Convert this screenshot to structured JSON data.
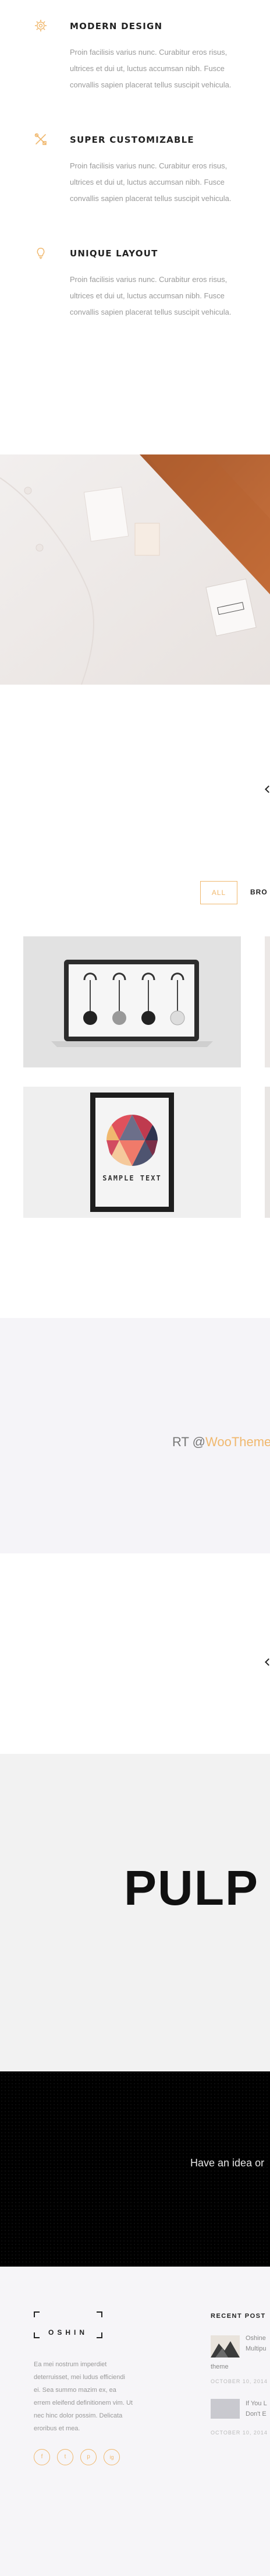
{
  "features": [
    {
      "icon": "gear-icon",
      "title": "MODERN DESIGN",
      "text": "Proin facilisis varius nunc. Curabitur eros risus, ultrices et dui ut, luctus accumsan nibh. Fusce convallis sapien placerat tellus suscipit vehicula."
    },
    {
      "icon": "tools-icon",
      "title": "SUPER  CUSTOMIZABLE",
      "text": "Proin facilisis varius nunc. Curabitur eros risus, ultrices et dui ut, luctus accumsan nibh. Fusce convallis sapien placerat tellus suscipit vehicula."
    },
    {
      "icon": "lightbulb-icon",
      "title": "UNIQUE LAYOUT",
      "text": "Proin facilisis varius nunc. Curabitur eros risus, ultrices et dui ut, luctus accumsan nibh. Fusce convallis sapien placerat tellus suscipit vehicula."
    }
  ],
  "portfolio": {
    "filters": [
      "ALL",
      "BRO"
    ],
    "poster_label": "SAMPLE TEXT"
  },
  "quote": {
    "prefix": "RT @",
    "handle": "WooThemes:"
  },
  "pulp": {
    "text": "PULP"
  },
  "cta": {
    "text": "Have an idea or"
  },
  "footer": {
    "logo": "OSHIN",
    "about": "Ea mei nostrum imperdiet deterruisset, mei ludus efficiendi ei. Sea summo mazim ex, ea errem eleifend definitionem vim. Ut nec hinc dolor possim. Delicata eroribus et mea.",
    "social": [
      "f",
      "t",
      "p",
      "ig"
    ],
    "recent_posts_title": "RECENT POST",
    "posts": [
      {
        "title_l1": "Oshine",
        "title_l2": "Multipu",
        "title_l3": "theme",
        "date": "OCTOBER 10, 2014"
      },
      {
        "title_l1": "If You L",
        "title_l2": "Don't E",
        "date": "OCTOBER 10, 2014"
      }
    ]
  },
  "colors": {
    "accent": "#f0b86e",
    "dark": "#000000"
  }
}
